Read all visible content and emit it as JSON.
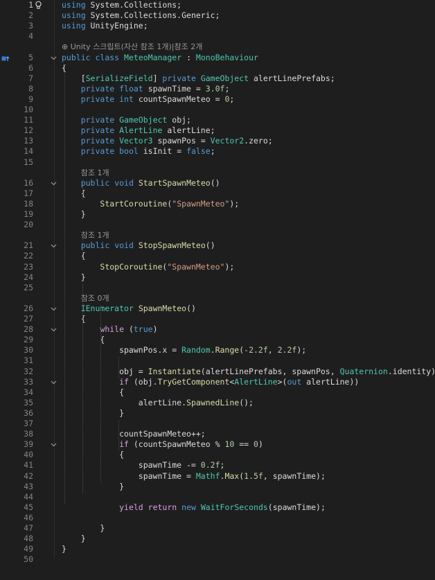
{
  "colors": {
    "background": "#1e1e1e",
    "keyword": "#569cd6",
    "type": "#4ec9b0",
    "method": "#dcdcaa",
    "string": "#d69d85",
    "number": "#b5cea8",
    "control": "#d8a0df",
    "text": "#dcdcdc",
    "line_number": "#858585",
    "codelens": "#999999"
  },
  "icons": {
    "lightbulb": "lightbulb-icon",
    "class_marker": "class-definition-icon",
    "fold": "chevron-down-icon"
  },
  "lens": {
    "class": "Unity 스크립트(자산 참조 1개)|참조 2개",
    "start_spawn": "참조 1개",
    "stop_spawn": "참조 1개",
    "spawn_meteo": "참조 0개"
  },
  "lines": [
    {
      "n": "1",
      "fold": false,
      "tokens": [
        {
          "c": "kw",
          "t": "using"
        },
        {
          "t": " System.Collections;"
        }
      ]
    },
    {
      "n": "2",
      "fold": false,
      "tokens": [
        {
          "c": "kw",
          "t": "using"
        },
        {
          "t": " System.Collections.Generic;"
        }
      ]
    },
    {
      "n": "3",
      "fold": false,
      "tokens": [
        {
          "c": "kw",
          "t": "using"
        },
        {
          "t": " UnityEngine;"
        }
      ]
    },
    {
      "n": "4",
      "fold": false,
      "tokens": []
    },
    {
      "lens": "class"
    },
    {
      "n": "5",
      "fold": true,
      "tokens": [
        {
          "c": "kw",
          "t": "public"
        },
        {
          "t": " "
        },
        {
          "c": "kw",
          "t": "class"
        },
        {
          "t": " "
        },
        {
          "c": "ty",
          "t": "MeteoManager"
        },
        {
          "t": " : "
        },
        {
          "c": "ty",
          "t": "MonoBehaviour"
        }
      ]
    },
    {
      "n": "6",
      "fold": false,
      "tokens": [
        {
          "t": "{"
        }
      ]
    },
    {
      "n": "7",
      "fold": false,
      "tokens": [
        {
          "t": "    ["
        },
        {
          "c": "ty",
          "t": "SerializeField"
        },
        {
          "t": "] "
        },
        {
          "c": "kw",
          "t": "private"
        },
        {
          "t": " "
        },
        {
          "c": "ty",
          "t": "GameObject"
        },
        {
          "t": " alertLinePrefabs;"
        }
      ]
    },
    {
      "n": "8",
      "fold": false,
      "tokens": [
        {
          "t": "    "
        },
        {
          "c": "kw",
          "t": "private"
        },
        {
          "t": " "
        },
        {
          "c": "kw",
          "t": "float"
        },
        {
          "t": " spawnTime = "
        },
        {
          "c": "nm",
          "t": "3.0f"
        },
        {
          "t": ";"
        }
      ]
    },
    {
      "n": "9",
      "fold": false,
      "tokens": [
        {
          "t": "    "
        },
        {
          "c": "kw",
          "t": "private"
        },
        {
          "t": " "
        },
        {
          "c": "kw",
          "t": "int"
        },
        {
          "t": " countSpawnMeteo = "
        },
        {
          "c": "nm",
          "t": "0"
        },
        {
          "t": ";"
        }
      ]
    },
    {
      "n": "10",
      "fold": false,
      "tokens": []
    },
    {
      "n": "11",
      "fold": false,
      "tokens": [
        {
          "t": "    "
        },
        {
          "c": "kw",
          "t": "private"
        },
        {
          "t": " "
        },
        {
          "c": "ty",
          "t": "GameObject"
        },
        {
          "t": " obj;"
        }
      ]
    },
    {
      "n": "12",
      "fold": false,
      "tokens": [
        {
          "t": "    "
        },
        {
          "c": "kw",
          "t": "private"
        },
        {
          "t": " "
        },
        {
          "c": "ty",
          "t": "AlertLine"
        },
        {
          "t": " alertLine;"
        }
      ]
    },
    {
      "n": "13",
      "fold": false,
      "tokens": [
        {
          "t": "    "
        },
        {
          "c": "kw",
          "t": "private"
        },
        {
          "t": " "
        },
        {
          "c": "ty",
          "t": "Vector3"
        },
        {
          "t": " spawnPos = "
        },
        {
          "c": "ty",
          "t": "Vector2"
        },
        {
          "t": ".zero;"
        }
      ]
    },
    {
      "n": "14",
      "fold": false,
      "tokens": [
        {
          "t": "    "
        },
        {
          "c": "kw",
          "t": "private"
        },
        {
          "t": " "
        },
        {
          "c": "kw",
          "t": "bool"
        },
        {
          "t": " isInit = "
        },
        {
          "c": "kw",
          "t": "false"
        },
        {
          "t": ";"
        }
      ]
    },
    {
      "n": "15",
      "fold": false,
      "tokens": []
    },
    {
      "lens": "start_spawn"
    },
    {
      "n": "16",
      "fold": true,
      "tokens": [
        {
          "t": "    "
        },
        {
          "c": "kw",
          "t": "public"
        },
        {
          "t": " "
        },
        {
          "c": "kw",
          "t": "void"
        },
        {
          "t": " "
        },
        {
          "c": "mt",
          "t": "StartSpawnMeteo"
        },
        {
          "t": "()"
        }
      ]
    },
    {
      "n": "17",
      "fold": false,
      "tokens": [
        {
          "t": "    {"
        }
      ]
    },
    {
      "n": "18",
      "fold": false,
      "tokens": [
        {
          "t": "        "
        },
        {
          "c": "mt",
          "t": "StartCoroutine"
        },
        {
          "t": "("
        },
        {
          "c": "st",
          "t": "\"SpawnMeteo\""
        },
        {
          "t": ");"
        }
      ]
    },
    {
      "n": "19",
      "fold": false,
      "tokens": [
        {
          "t": "    }"
        }
      ]
    },
    {
      "n": "20",
      "fold": false,
      "tokens": []
    },
    {
      "lens": "stop_spawn"
    },
    {
      "n": "21",
      "fold": true,
      "tokens": [
        {
          "t": "    "
        },
        {
          "c": "kw",
          "t": "public"
        },
        {
          "t": " "
        },
        {
          "c": "kw",
          "t": "void"
        },
        {
          "t": " "
        },
        {
          "c": "mt",
          "t": "StopSpawnMeteo"
        },
        {
          "t": "()"
        }
      ]
    },
    {
      "n": "22",
      "fold": false,
      "tokens": [
        {
          "t": "    {"
        }
      ]
    },
    {
      "n": "23",
      "fold": false,
      "tokens": [
        {
          "t": "        "
        },
        {
          "c": "mt",
          "t": "StopCoroutine"
        },
        {
          "t": "("
        },
        {
          "c": "st",
          "t": "\"SpawnMeteo\""
        },
        {
          "t": ");"
        }
      ]
    },
    {
      "n": "24",
      "fold": false,
      "tokens": [
        {
          "t": "    }"
        }
      ]
    },
    {
      "n": "25",
      "fold": false,
      "tokens": []
    },
    {
      "lens": "spawn_meteo"
    },
    {
      "n": "26",
      "fold": true,
      "tokens": [
        {
          "t": "    "
        },
        {
          "c": "ty",
          "t": "IEnumerator"
        },
        {
          "t": " "
        },
        {
          "c": "mt",
          "t": "SpawnMeteo"
        },
        {
          "t": "()"
        }
      ]
    },
    {
      "n": "27",
      "fold": false,
      "tokens": [
        {
          "t": "    {"
        }
      ]
    },
    {
      "n": "28",
      "fold": true,
      "tokens": [
        {
          "t": "        "
        },
        {
          "c": "cf",
          "t": "while"
        },
        {
          "t": " ("
        },
        {
          "c": "kw",
          "t": "true"
        },
        {
          "t": ")"
        }
      ]
    },
    {
      "n": "29",
      "fold": false,
      "tokens": [
        {
          "t": "        {"
        }
      ]
    },
    {
      "n": "30",
      "fold": false,
      "tokens": [
        {
          "t": "            spawnPos.x = "
        },
        {
          "c": "ty",
          "t": "Random"
        },
        {
          "t": "."
        },
        {
          "c": "mt",
          "t": "Range"
        },
        {
          "t": "("
        },
        {
          "c": "nm",
          "t": "-2.2f"
        },
        {
          "t": ", "
        },
        {
          "c": "nm",
          "t": "2.2f"
        },
        {
          "t": ");"
        }
      ]
    },
    {
      "n": "31",
      "fold": false,
      "tokens": []
    },
    {
      "n": "32",
      "fold": false,
      "tokens": [
        {
          "t": "            obj = "
        },
        {
          "c": "mt",
          "t": "Instantiate"
        },
        {
          "t": "(alertLinePrefabs, spawnPos, "
        },
        {
          "c": "ty",
          "t": "Quaternion"
        },
        {
          "t": ".identity);"
        }
      ]
    },
    {
      "n": "33",
      "fold": true,
      "tokens": [
        {
          "t": "            "
        },
        {
          "c": "cf",
          "t": "if"
        },
        {
          "t": " (obj."
        },
        {
          "c": "mt",
          "t": "TryGetComponent"
        },
        {
          "t": "<"
        },
        {
          "c": "ty",
          "t": "AlertLine"
        },
        {
          "t": ">("
        },
        {
          "c": "kw",
          "t": "out"
        },
        {
          "t": " alertLine))"
        }
      ]
    },
    {
      "n": "34",
      "fold": false,
      "tokens": [
        {
          "t": "            {"
        }
      ]
    },
    {
      "n": "35",
      "fold": false,
      "tokens": [
        {
          "t": "                alertLine."
        },
        {
          "c": "mt",
          "t": "SpawnedLine"
        },
        {
          "t": "();"
        }
      ]
    },
    {
      "n": "36",
      "fold": false,
      "tokens": [
        {
          "t": "            }"
        }
      ]
    },
    {
      "n": "37",
      "fold": false,
      "tokens": []
    },
    {
      "n": "38",
      "fold": false,
      "tokens": [
        {
          "t": "            countSpawnMeteo++;"
        }
      ]
    },
    {
      "n": "39",
      "fold": true,
      "tokens": [
        {
          "t": "            "
        },
        {
          "c": "cf",
          "t": "if"
        },
        {
          "t": " (countSpawnMeteo % "
        },
        {
          "c": "nm",
          "t": "10"
        },
        {
          "t": " == "
        },
        {
          "c": "nm",
          "t": "0"
        },
        {
          "t": ")"
        }
      ]
    },
    {
      "n": "40",
      "fold": false,
      "tokens": [
        {
          "t": "            {"
        }
      ]
    },
    {
      "n": "41",
      "fold": false,
      "tokens": [
        {
          "t": "                spawnTime -= "
        },
        {
          "c": "nm",
          "t": "0.2f"
        },
        {
          "t": ";"
        }
      ]
    },
    {
      "n": "42",
      "fold": false,
      "tokens": [
        {
          "t": "                spawnTime = "
        },
        {
          "c": "ty",
          "t": "Mathf"
        },
        {
          "t": "."
        },
        {
          "c": "mt",
          "t": "Max"
        },
        {
          "t": "("
        },
        {
          "c": "nm",
          "t": "1.5f"
        },
        {
          "t": ", spawnTime);"
        }
      ]
    },
    {
      "n": "43",
      "fold": false,
      "tokens": [
        {
          "t": "            }"
        }
      ]
    },
    {
      "n": "44",
      "fold": false,
      "tokens": []
    },
    {
      "n": "45",
      "fold": false,
      "tokens": [
        {
          "t": "            "
        },
        {
          "c": "cf",
          "t": "yield"
        },
        {
          "t": " "
        },
        {
          "c": "cf",
          "t": "return"
        },
        {
          "t": " "
        },
        {
          "c": "kw",
          "t": "new"
        },
        {
          "t": " "
        },
        {
          "c": "ty",
          "t": "WaitForSeconds"
        },
        {
          "t": "(spawnTime);"
        }
      ]
    },
    {
      "n": "46",
      "fold": false,
      "tokens": []
    },
    {
      "n": "47",
      "fold": false,
      "tokens": [
        {
          "t": "        }"
        }
      ]
    },
    {
      "n": "48",
      "fold": false,
      "tokens": [
        {
          "t": "    }"
        }
      ]
    },
    {
      "n": "49",
      "fold": false,
      "tokens": [
        {
          "t": "}"
        }
      ]
    },
    {
      "n": "50",
      "fold": false,
      "tokens": []
    }
  ]
}
